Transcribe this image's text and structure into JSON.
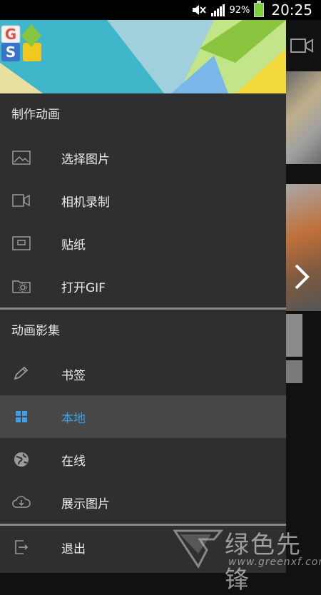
{
  "status_bar": {
    "battery_percent": "92%",
    "time": "20:25",
    "icons": [
      "mute-icon",
      "signal-icon",
      "battery-icon"
    ]
  },
  "drawer": {
    "sections": [
      {
        "title": "制作动画",
        "items": [
          {
            "label": "选择图片",
            "icon": "image-icon"
          },
          {
            "label": "相机录制",
            "icon": "video-camera-icon"
          },
          {
            "label": "贴纸",
            "icon": "sticker-icon"
          },
          {
            "label": "打开GIF",
            "icon": "folder-gear-icon"
          }
        ]
      },
      {
        "title": "动画影集",
        "items": [
          {
            "label": "书签",
            "icon": "pencil-icon"
          },
          {
            "label": "本地",
            "icon": "grid-icon",
            "active": true
          },
          {
            "label": "在线",
            "icon": "globe-icon"
          },
          {
            "label": "展示图片",
            "icon": "cloud-download-icon"
          }
        ]
      },
      {
        "items": [
          {
            "label": "退出",
            "icon": "exit-icon"
          }
        ]
      }
    ]
  },
  "colors": {
    "accent": "#3a9fe6",
    "drawer_bg": "#2f2f2f",
    "active_bg": "#474747",
    "header_bg": "#5cc6d6"
  },
  "watermark": {
    "text": "绿色先锋",
    "url_text": "www.greenxf.com"
  }
}
